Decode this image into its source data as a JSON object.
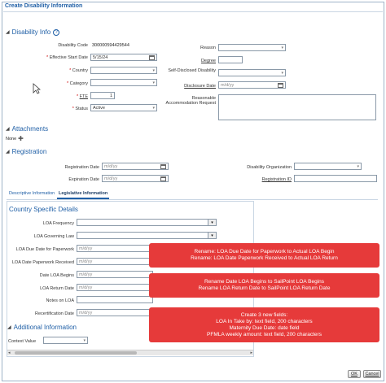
{
  "title": "Create Disability Information",
  "disability": {
    "section_title": "Disability Info",
    "disability_code_label": "Disability Code",
    "disability_code_value": "300000594429544",
    "effective_start_date_label": "Effective Start Date",
    "effective_start_date_value": "5/15/24",
    "country_label": "Country",
    "category_label": "Category",
    "fte_label": "FTE",
    "fte_value": "1",
    "status_label": "Status",
    "status_value": "Active",
    "reason_label": "Reason",
    "degree_label": "Degree",
    "self_disclosed_label": "Self-Disclosed Disability",
    "disclosure_date_label": "Disclosure Date",
    "reasonable_accommodation_label": "Reasonable Accommodation Request",
    "date_placeholder": "m/d/yy"
  },
  "attachments": {
    "section_title": "Attachments",
    "none_label": "None"
  },
  "registration": {
    "section_title": "Registration",
    "registration_date_label": "Registration Date",
    "expiration_date_label": "Expiration Date",
    "disability_organization_label": "Disability Organization",
    "registration_id_label": "Registration ID"
  },
  "tabs": [
    {
      "label": "Descriptive Information"
    },
    {
      "label": "Legislative Information"
    }
  ],
  "country_specific": {
    "title": "Country Specific Details",
    "loa_frequency_label": "LOA Frequency",
    "loa_governing_law_label": "LOA Governing Law",
    "loa_due_date_paperwork_label": "LOA Due Date for Paperwork",
    "loa_date_paperwork_received_label": "LOA Date Paperwork Received",
    "date_loa_begins_label": "Date LOA Begins",
    "loa_return_date_label": "LOA Return Date",
    "notes_on_loa_label": "Notes on LOA",
    "recertification_date_label": "Recertification Date"
  },
  "additional": {
    "section_title": "Additional Information",
    "context_value_label": "Context Value"
  },
  "annotations": [
    {
      "lines": [
        "Rename: LOA Due Date for Paperwork to Actual LOA Begin",
        "Rename: LOA Date Paperwork Received to Actual LOA Return"
      ]
    },
    {
      "lines": [
        "Rename Date LOA Begins to SailPoint LOA Begins",
        "Rename LOA Return Date to SailPoint LOA Return Date"
      ]
    },
    {
      "lines": [
        "Create 3 new fields:",
        "LOA In Take by: text field, 200 characters",
        "Maternity Due Date: date field",
        "PFMLA weekly amount: text field, 200 characters"
      ]
    }
  ],
  "buttons": {
    "ok_label": "OK",
    "cancel_label": "Cancel"
  },
  "colors": {
    "accent": "#1f5fa6",
    "annotation_red": "#e63a3a"
  }
}
